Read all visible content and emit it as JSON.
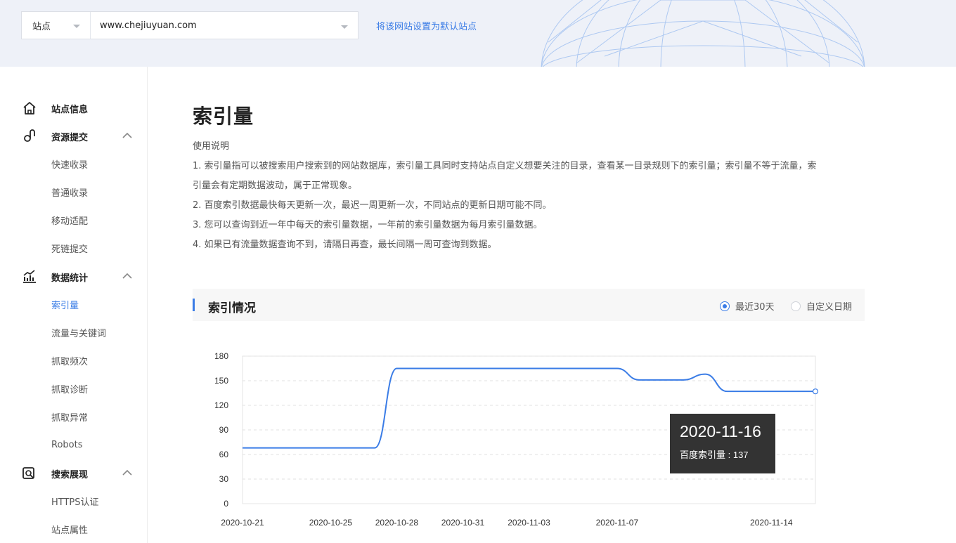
{
  "header": {
    "site_type_label": "站点",
    "site_domain": "www.chejiuyuan.com",
    "set_default_link": "将该网站设置为默认站点"
  },
  "sidebar": {
    "groups": [
      {
        "label": "站点信息",
        "icon": "home-icon"
      },
      {
        "label": "资源提交",
        "icon": "submit-icon",
        "items": [
          "快速收录",
          "普通收录",
          "移动适配",
          "死链提交"
        ]
      },
      {
        "label": "数据统计",
        "icon": "stats-icon",
        "items": [
          "索引量",
          "流量与关键词",
          "抓取频次",
          "抓取诊断",
          "抓取异常",
          "Robots"
        ]
      },
      {
        "label": "搜索展现",
        "icon": "search-display-icon",
        "items": [
          "HTTPS认证",
          "站点属性"
        ]
      }
    ],
    "active_item": "索引量"
  },
  "main": {
    "title": "索引量",
    "usage_title": "使用说明",
    "usage_lines": [
      "1. 索引量指可以被搜索用户搜索到的网站数据库，索引量工具同时支持站点自定义想要关注的目录，查看某一目录规则下的索引量；索引量不等于流量，索",
      "引量会有定期数据波动，属于正常现象。",
      "2. 百度索引数据最快每天更新一次，最迟一周更新一次，不同站点的更新日期可能不同。",
      "3. 您可以查询到近一年中每天的索引量数据，一年前的索引量数据为每月索引量数据。",
      "4. 如果已有流量数据查询不到，请隔日再查，最长间隔一周可查询到数据。"
    ],
    "section_title": "索引情况",
    "range_options": [
      "最近30天",
      "自定义日期"
    ],
    "range_selected": "最近30天"
  },
  "colors": {
    "accent": "#3a7ce6",
    "line": "#3a7ce6",
    "tooltip_bg": "#333333"
  },
  "chart_data": {
    "type": "line",
    "x_tick_labels": [
      "2020-10-21",
      "2020-10-25",
      "2020-10-28",
      "2020-10-31",
      "2020-11-03",
      "2020-11-07",
      "2020-11-14"
    ],
    "y_ticks": [
      0,
      30,
      60,
      90,
      120,
      150,
      180
    ],
    "ylim": [
      0,
      180
    ],
    "series": [
      {
        "name": "百度索引量",
        "x": [
          "2020-10-21",
          "2020-10-22",
          "2020-10-23",
          "2020-10-24",
          "2020-10-25",
          "2020-10-26",
          "2020-10-27",
          "2020-10-28",
          "2020-10-29",
          "2020-10-30",
          "2020-10-31",
          "2020-11-01",
          "2020-11-02",
          "2020-11-03",
          "2020-11-04",
          "2020-11-05",
          "2020-11-06",
          "2020-11-07",
          "2020-11-08",
          "2020-11-09",
          "2020-11-10",
          "2020-11-11",
          "2020-11-12",
          "2020-11-13",
          "2020-11-14",
          "2020-11-15",
          "2020-11-16"
        ],
        "values": [
          68,
          68,
          68,
          68,
          68,
          68,
          68,
          165,
          165,
          165,
          165,
          165,
          165,
          165,
          165,
          165,
          165,
          165,
          151,
          151,
          151,
          158,
          137,
          137,
          137,
          137,
          137
        ]
      }
    ],
    "grid": "horizontal dashed",
    "tooltip": {
      "date": "2020-11-16",
      "label": "百度索引量 : 137"
    }
  }
}
